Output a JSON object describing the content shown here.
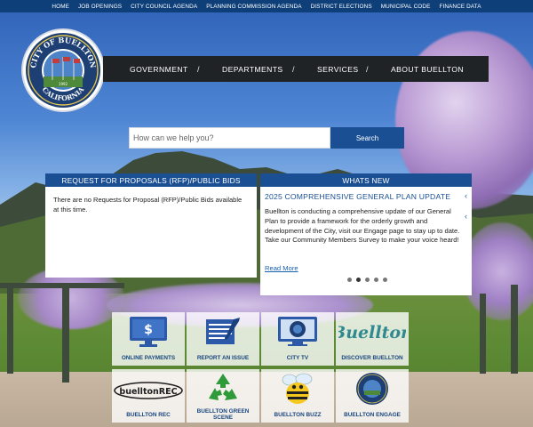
{
  "topnav": [
    "HOME",
    "JOB OPENINGS",
    "CITY COUNCIL AGENDA",
    "PLANNING COMMISSION AGENDA",
    "DISTRICT ELECTIONS",
    "MUNICIPAL CODE",
    "FINANCE DATA"
  ],
  "seal": {
    "top_text": "CITY OF BUELLTON",
    "bottom_text": "CALIFORNIA",
    "year": "1992"
  },
  "mainnav": [
    "GOVERNMENT",
    "DEPARTMENTS",
    "SERVICES",
    "ABOUT BUELLTON"
  ],
  "mainnav_separator": "/",
  "search": {
    "placeholder": "How can we help you?",
    "button": "Search"
  },
  "rfp": {
    "title": "REQUEST FOR PROPOSALS (RFP)/PUBLIC BIDS",
    "body": "There are no Requests for Proposal (RFP)/Public Bids available at this time."
  },
  "whats_new": {
    "title": "WHATS NEW",
    "headline": "2025 COMPREHENSIVE GENERAL PLAN UPDATE",
    "body": "Buellton is conducting a comprehensive update of our General Plan to provide a framework for the orderly growth and development of the City, visit our Engage page to stay up to date. Take our Community Members Survey to make your voice heard!",
    "read_more": "Read More",
    "prev_glyph": "‹",
    "next_glyph": "‹",
    "slides": 5,
    "active_slide": 2
  },
  "tiles": [
    {
      "label": "ONLINE PAYMENTS",
      "icon": "monitor-dollar-icon"
    },
    {
      "label": "REPORT AN ISSUE",
      "icon": "notepad-pencil-icon"
    },
    {
      "label": "CITY TV",
      "icon": "tv-seal-icon"
    },
    {
      "label": "DISCOVER BUELLTON",
      "icon": "buellton-script-logo",
      "logo_text": "Buellton"
    },
    {
      "label": "BUELLTON REC",
      "icon": "buellton-rec-logo",
      "logo_text": "buelltonREC"
    },
    {
      "label": "BUELLTON GREEN SCENE",
      "icon": "recycle-icon"
    },
    {
      "label": "BUELLTON BUZZ",
      "icon": "bee-icon"
    },
    {
      "label": "BUELLTON ENGAGE",
      "icon": "engage-seal-icon"
    }
  ],
  "colors": {
    "nav_blue": "#0e3f78",
    "primary_blue": "#1a4f93",
    "main_nav_bg": "#1f2326",
    "tile_text": "#17457e"
  }
}
